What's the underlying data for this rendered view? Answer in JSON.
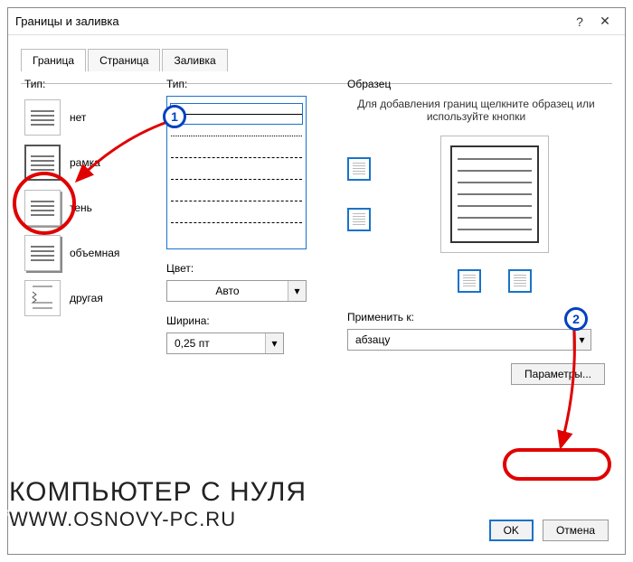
{
  "title": "Границы и заливка",
  "tabs": {
    "border": "Граница",
    "page": "Страница",
    "fill": "Заливка"
  },
  "labels": {
    "type": "Тип:",
    "style": "Тип:",
    "color": "Цвет:",
    "width": "Ширина:",
    "preview": "Образец",
    "help": "Для добавления границ щелкните образец или используйте кнопки",
    "applyTo": "Применить к:",
    "options": "Параметры...",
    "ok": "OK",
    "cancel": "Отмена"
  },
  "types": {
    "none": "нет",
    "box": "рамка",
    "shadow": "тень",
    "threeD": "объемная",
    "custom": "другая"
  },
  "color_value": "Авто",
  "width_value": "0,25 пт",
  "apply_value": "абзацу",
  "callouts": {
    "one": "1",
    "two": "2"
  },
  "watermark": {
    "line1": "КОМПЬЮТЕР С НУЛЯ",
    "line2": "WWW.OSNOVY-PC.RU"
  }
}
